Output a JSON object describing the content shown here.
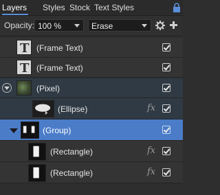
{
  "tabs": [
    {
      "label": "Layers",
      "active": true
    },
    {
      "label": "Styles",
      "active": false
    },
    {
      "label": "Stock",
      "active": false
    },
    {
      "label": "Text Styles",
      "active": false
    }
  ],
  "toolbar": {
    "opacity_label": "Opacity:",
    "opacity_value": "100 %",
    "blend_mode": "Erase",
    "settings_icon": "gear-icon",
    "add_icon": "plus-icon",
    "lock_icon": "lock-icon"
  },
  "layers": [
    {
      "name": "(Frame Text)",
      "type": "frame-text",
      "visible": true,
      "fx": false
    },
    {
      "name": "(Frame Text)",
      "type": "frame-text",
      "visible": true,
      "fx": false
    },
    {
      "name": "(Pixel)",
      "type": "pixel",
      "visible": true,
      "fx": false,
      "expanded": true
    },
    {
      "name": "(Ellipse)",
      "type": "ellipse",
      "visible": true,
      "fx": true
    },
    {
      "name": "(Group)",
      "type": "group",
      "visible": true,
      "fx": false,
      "expanded": true,
      "selected": true
    },
    {
      "name": "(Rectangle)",
      "type": "rectangle",
      "visible": true,
      "fx": true
    },
    {
      "name": "(Rectangle)",
      "type": "rectangle",
      "visible": true,
      "fx": true
    }
  ],
  "fx_label": "fx",
  "colors": {
    "accent": "#4a7cc8",
    "tab_underline": "#5b8fd9",
    "panel_bg": "#2e2e2e"
  }
}
